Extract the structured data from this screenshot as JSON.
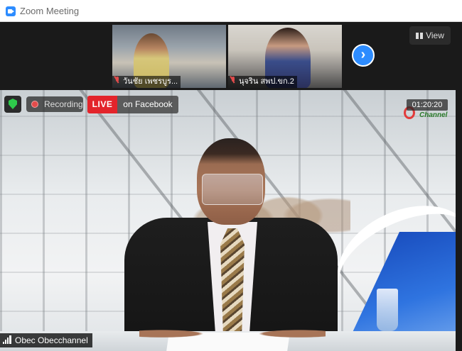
{
  "window": {
    "title": "Zoom Meeting"
  },
  "gallery": {
    "participants": [
      {
        "name": "วันชัย เพชรบูร..."
      },
      {
        "name": "นุจริน สพป.ขก.2"
      }
    ],
    "next_icon": "chevron-right-icon"
  },
  "view_button": {
    "label": "View"
  },
  "main_video": {
    "recording_label": "Recording",
    "live_label": "LIVE",
    "live_destination": "on Facebook",
    "timecode": "01:20:20",
    "channel_text": "Channel",
    "speaker_name": "Obec Obecchannel"
  },
  "colors": {
    "accent": "#2d8cff",
    "live_red": "#e3242b",
    "recording_red": "#e24b4b",
    "encryption_green": "#2ec94b"
  }
}
